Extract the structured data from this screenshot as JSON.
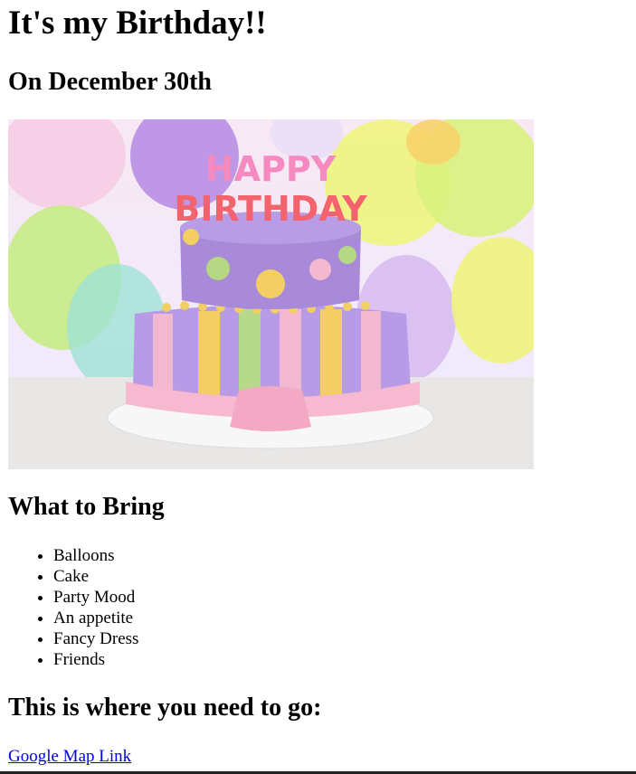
{
  "heading": "It's my Birthday!!",
  "subheading": "On December 30th",
  "image": {
    "cake_text_top": "HAPPY",
    "cake_text_bottom": "BIRTHDAY"
  },
  "bring": {
    "title": "What to Bring",
    "items": [
      "Balloons",
      "Cake",
      "Party Mood",
      "An appetite",
      "Fancy Dress",
      "Friends"
    ]
  },
  "directions": {
    "title": "This is where you need to go:",
    "link_text": "Google Map Link"
  }
}
